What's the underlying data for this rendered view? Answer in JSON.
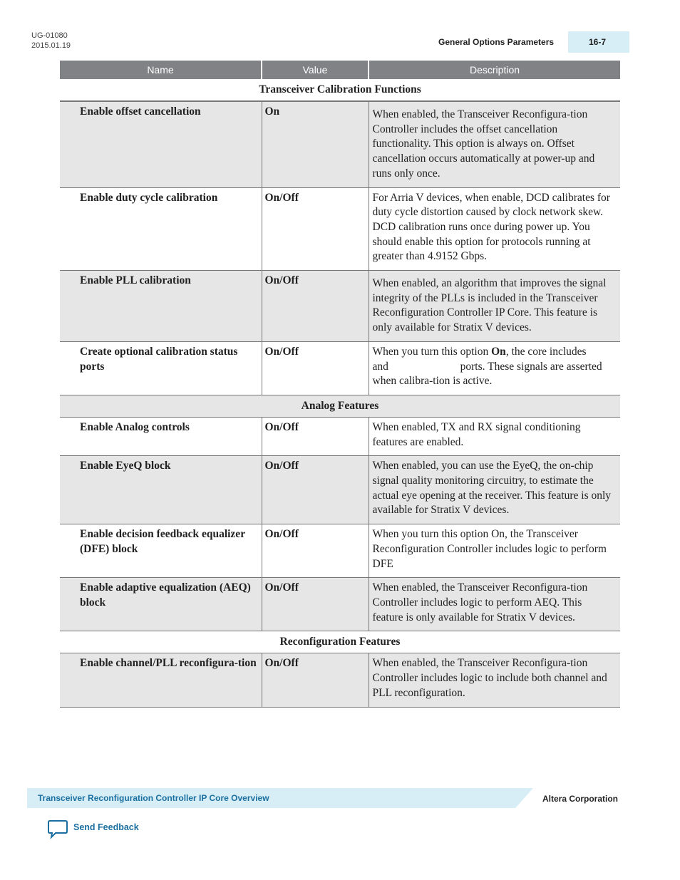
{
  "header": {
    "doc_id": "UG-01080",
    "date": "2015.01.19",
    "section_title": "General Options Parameters",
    "page_number": "16-7"
  },
  "table": {
    "columns": [
      "Name",
      "Value",
      "Description"
    ],
    "sections": [
      {
        "title": "Transceiver Calibration Functions",
        "rows": [
          {
            "name": "Enable offset cancellation",
            "value": "On",
            "description": "When enabled, the Transceiver Reconfigura-tion Controller includes the offset cancellation functionality. This option is always on. Offset cancellation occurs automatically at power-up and runs only once."
          },
          {
            "name": "Enable duty cycle calibration",
            "value": "On/Off",
            "description": "For Arria V devices, when enable, DCD calibrates for duty cycle distortion caused by clock network skew. DCD calibration runs once during power up. You should enable this option for protocols running at greater than 4.9152 Gbps."
          },
          {
            "name": "Enable PLL calibration",
            "value": "On/Off",
            "description": "When enabled, an algorithm that improves the signal integrity of the PLLs is included in the Transceiver Reconfiguration Controller IP Core. This feature is only available for Stratix V devices."
          },
          {
            "name": "Create optional calibration status ports",
            "value": "On/Off",
            "desc_pre": "When you turn this option ",
            "desc_bold": "On",
            "desc_post": ", the core includes                         and                          ports. These signals are asserted when calibra-tion is active."
          }
        ]
      },
      {
        "title": "Analog Features",
        "rows": [
          {
            "name": "Enable Analog controls",
            "value": "On/Off",
            "description": "When enabled, TX and RX signal conditioning features are enabled."
          },
          {
            "name": "Enable EyeQ block",
            "value": "On/Off",
            "description": "When enabled, you can use the EyeQ, the on-chip signal quality monitoring circuitry, to estimate the actual eye opening at the receiver. This feature is only available for Stratix V devices."
          },
          {
            "name": "Enable decision feedback equalizer (DFE) block",
            "value": "On/Off",
            "description": "When you turn this option On, the Transceiver Reconfiguration Controller includes logic to perform DFE"
          },
          {
            "name": "Enable adaptive equalization (AEQ) block",
            "value": "On/Off",
            "description": "When enabled, the Transceiver Reconfigura-tion Controller includes logic to perform AEQ. This feature is only available for Stratix V devices."
          }
        ]
      },
      {
        "title": "Reconfiguration Features",
        "rows": [
          {
            "name": "Enable channel/PLL reconfigura-tion",
            "value": "On/Off",
            "description": "When enabled, the Transceiver Reconfigura-tion Controller includes logic to include both channel and PLL reconfiguration."
          }
        ]
      }
    ]
  },
  "footer": {
    "chapter_link": "Transceiver Reconfiguration Controller IP Core Overview",
    "company": "Altera Corporation",
    "feedback_label": "Send Feedback",
    "feedback_icon": "speech-bubble-icon"
  }
}
